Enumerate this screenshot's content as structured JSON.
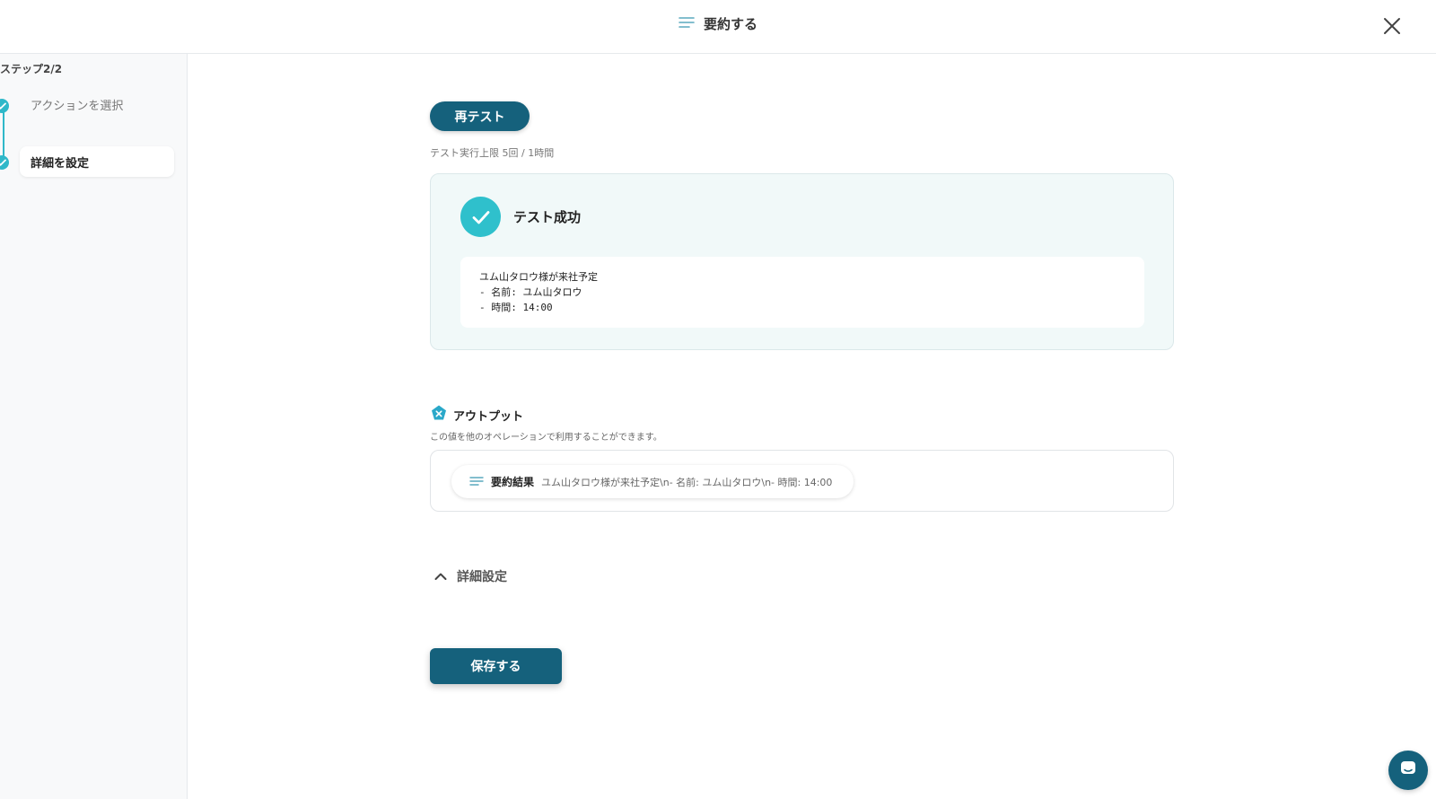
{
  "header": {
    "title": "要約する",
    "title_icon": "lines-icon",
    "close_icon": "close-icon"
  },
  "sidebar": {
    "step_count": "ステップ2/2",
    "steps": [
      {
        "label": "アクションを選択",
        "state": "done"
      },
      {
        "label": "詳細を設定",
        "state": "current"
      }
    ]
  },
  "test": {
    "retest_label": "再テスト",
    "limit_text": "テスト実行上限 5回 / 1時間",
    "success_title": "テスト成功",
    "result_lines": [
      "ユム山タロウ様が来社予定",
      "- 名前: ユム山タロウ",
      "- 時間: 14:00"
    ]
  },
  "output": {
    "title": "アウトプット",
    "description": "この値を他のオペレーションで利用することができます。",
    "items": [
      {
        "label": "要約結果",
        "value": "ユム山タロウ様が来社予定\\n- 名前: ユム山タロウ\\n- 時間: 14:00"
      }
    ]
  },
  "advanced": {
    "label": "詳細設定"
  },
  "actions": {
    "save_label": "保存する"
  },
  "colors": {
    "primary": "#15617c",
    "accent": "#2fc0cc",
    "success_bg": "#f1f9f9"
  }
}
